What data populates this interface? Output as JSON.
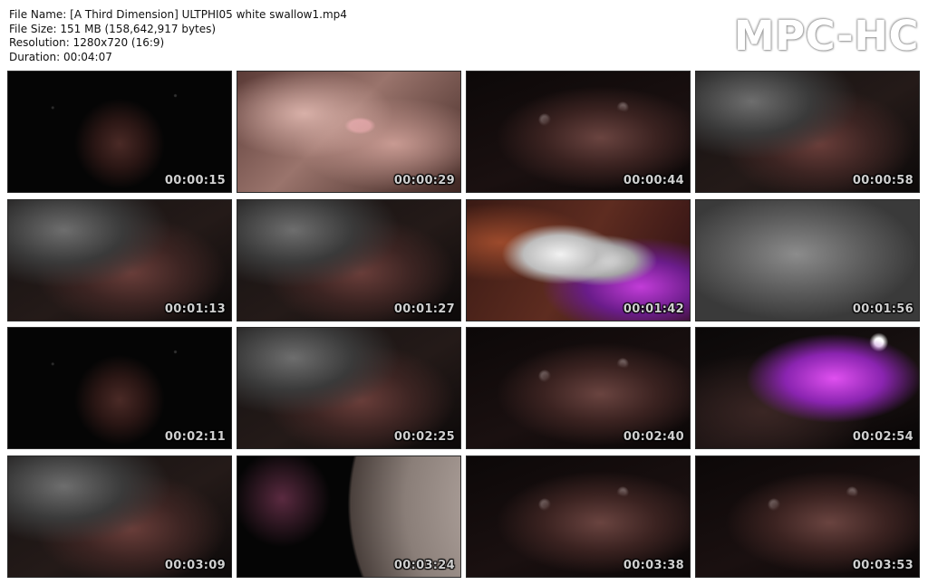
{
  "info": {
    "file_name": "File Name: [A Third Dimension] ULTPHI05 white swallow1.mp4",
    "file_size": "File Size: 151 MB (158,642,917 bytes)",
    "resolution": "Resolution: 1280x720 (16:9)",
    "duration": "Duration: 00:04:07"
  },
  "watermark": "MPC-HC",
  "thumbnails": [
    {
      "timestamp": "00:00:15",
      "scene": "dark-space"
    },
    {
      "timestamp": "00:00:29",
      "scene": "pink-surface"
    },
    {
      "timestamp": "00:00:44",
      "scene": "dark-creature"
    },
    {
      "timestamp": "00:00:58",
      "scene": "rock-creature"
    },
    {
      "timestamp": "00:01:13",
      "scene": "rock-creature"
    },
    {
      "timestamp": "00:01:27",
      "scene": "rock-creature"
    },
    {
      "timestamp": "00:01:42",
      "scene": "closeup-purple"
    },
    {
      "timestamp": "00:01:56",
      "scene": "grey-rock"
    },
    {
      "timestamp": "00:02:11",
      "scene": "dark-space"
    },
    {
      "timestamp": "00:02:25",
      "scene": "rock-creature"
    },
    {
      "timestamp": "00:02:40",
      "scene": "dark-creature"
    },
    {
      "timestamp": "00:02:54",
      "scene": "purple-glow"
    },
    {
      "timestamp": "00:03:09",
      "scene": "rock-creature"
    },
    {
      "timestamp": "00:03:24",
      "scene": "planet"
    },
    {
      "timestamp": "00:03:38",
      "scene": "dark-creature"
    },
    {
      "timestamp": "00:03:53",
      "scene": "dark-creature"
    }
  ]
}
